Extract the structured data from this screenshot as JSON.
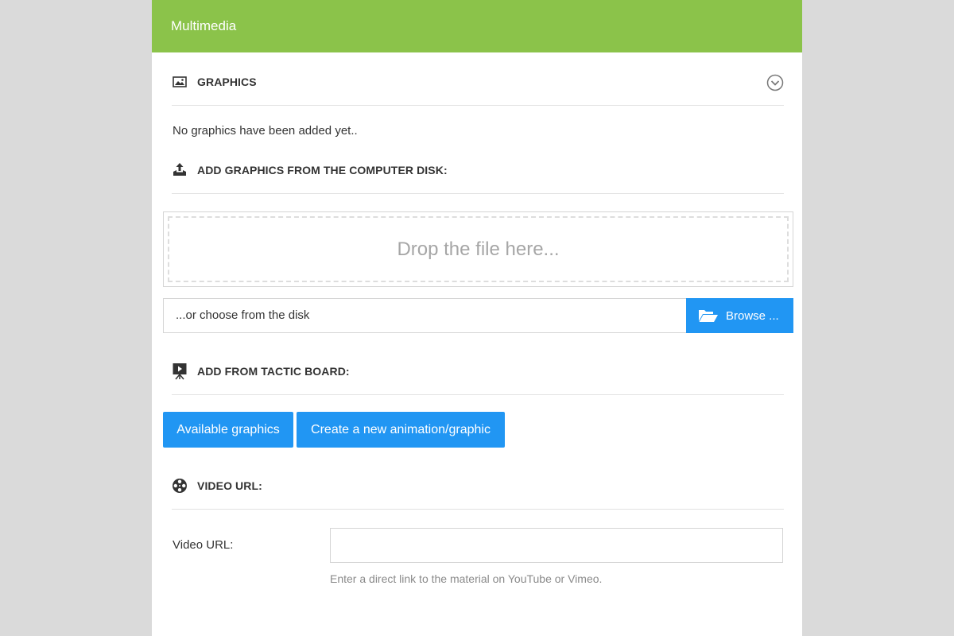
{
  "header": {
    "title": "Multimedia"
  },
  "graphics": {
    "title": "GRAPHICS",
    "empty_text": "No graphics have been added yet.."
  },
  "disk": {
    "title": "ADD GRAPHICS FROM THE COMPUTER DISK:",
    "drop_text": "Drop the file here...",
    "choose_text": "...or choose from the disk",
    "browse_label": "Browse ..."
  },
  "tactic": {
    "title": "ADD FROM TACTIC BOARD:",
    "available_label": "Available graphics",
    "create_label": "Create a new animation/graphic"
  },
  "video": {
    "title": "VIDEO URL:",
    "field_label": "Video URL:",
    "value": "",
    "help": "Enter a direct link to the material on YouTube or Vimeo."
  },
  "icons": {
    "graphics": "image-icon",
    "collapse": "chevron-down-circle-icon",
    "upload": "upload-icon",
    "folder": "folder-open-icon",
    "tactic": "presentation-board-icon",
    "video": "film-reel-icon"
  },
  "colors": {
    "header": "#8bc34a",
    "primary": "#2196f3",
    "background": "#dadada"
  }
}
